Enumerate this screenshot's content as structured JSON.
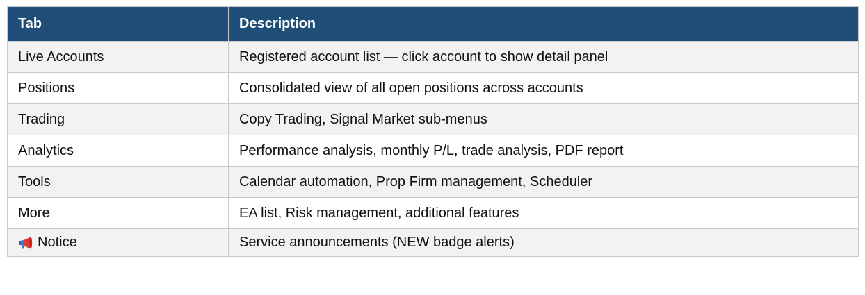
{
  "table": {
    "headers": {
      "tab": "Tab",
      "description": "Description"
    },
    "rows": [
      {
        "tab": "Live Accounts",
        "description": "Registered account list — click account to show detail panel"
      },
      {
        "tab": "Positions",
        "description": "Consolidated view of all open positions across accounts"
      },
      {
        "tab": "Trading",
        "description": "Copy Trading, Signal Market sub-menus"
      },
      {
        "tab": "Analytics",
        "description": "Performance analysis, monthly P/L, trade analysis, PDF report"
      },
      {
        "tab": "Tools",
        "description": "Calendar automation, Prop Firm management, Scheduler"
      },
      {
        "tab": "More",
        "description": "EA list, Risk management, additional features"
      },
      {
        "tab": "Notice",
        "icon": "megaphone-icon",
        "description": "Service announcements (NEW badge alerts)"
      }
    ]
  },
  "colors": {
    "header_bg": "#1f4e79",
    "header_text": "#ffffff",
    "alt_row_bg": "#f2f2f2",
    "border": "#c9c9c9"
  }
}
